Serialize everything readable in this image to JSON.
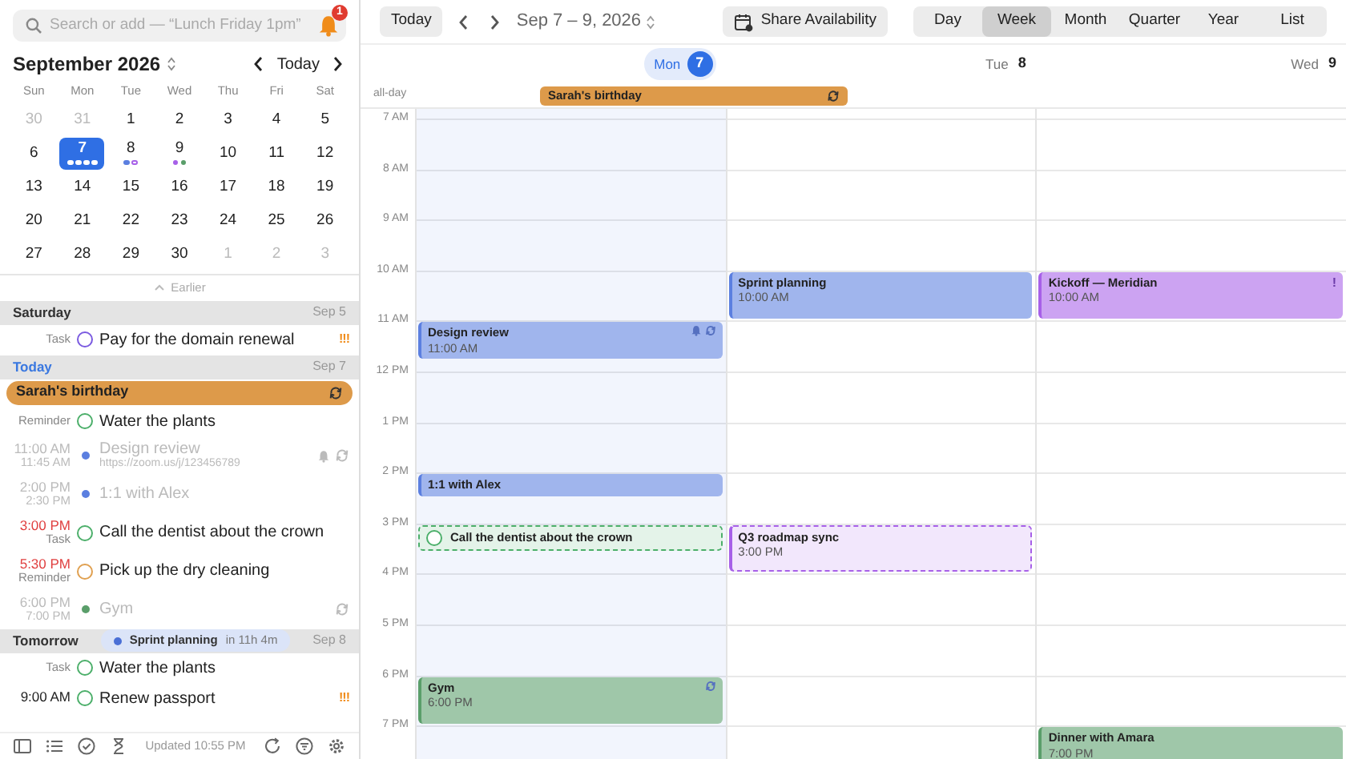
{
  "search": {
    "placeholder": "Search or add — “Lunch Friday 1pm”",
    "notifications": "1"
  },
  "mini_calendar": {
    "title": "September 2026",
    "today_button": "Today",
    "weekdays": [
      "Sun",
      "Mon",
      "Tue",
      "Wed",
      "Thu",
      "Fri",
      "Sat"
    ],
    "weeks": [
      [
        {
          "label": "30",
          "other_month": true,
          "selected": false
        },
        {
          "label": "31",
          "other_month": true,
          "selected": false
        },
        {
          "label": "1",
          "other_month": false,
          "selected": false
        },
        {
          "label": "2",
          "other_month": false,
          "selected": false
        },
        {
          "label": "3",
          "other_month": false,
          "selected": false
        },
        {
          "label": "4",
          "other_month": false,
          "selected": false
        },
        {
          "label": "5",
          "other_month": false,
          "selected": false
        }
      ],
      [
        {
          "label": "6",
          "other_month": false,
          "selected": false
        },
        {
          "label": "7",
          "other_month": false,
          "selected": true,
          "dots": [
            {
              "color": "#ffffff",
              "kind": "event"
            },
            {
              "color": "#ffffff",
              "kind": "event"
            },
            {
              "color": "#ffffff",
              "kind": "event"
            },
            {
              "color": "#ffffff",
              "kind": "event"
            }
          ]
        },
        {
          "label": "8",
          "other_month": false,
          "selected": false,
          "dots": [
            {
              "color": "#5b7fe0",
              "kind": "event"
            },
            {
              "color": "#a760e8",
              "kind": "task"
            }
          ]
        },
        {
          "label": "9",
          "other_month": false,
          "selected": false,
          "dots": [
            {
              "color": "#a760e8",
              "kind": "event"
            },
            {
              "color": "#5a9e6a",
              "kind": "event"
            }
          ]
        },
        {
          "label": "10",
          "other_month": false,
          "selected": false
        },
        {
          "label": "11",
          "other_month": false,
          "selected": false
        },
        {
          "label": "12",
          "other_month": false,
          "selected": false
        }
      ],
      [
        {
          "label": "13",
          "other_month": false,
          "selected": false
        },
        {
          "label": "14",
          "other_month": false,
          "selected": false
        },
        {
          "label": "15",
          "other_month": false,
          "selected": false
        },
        {
          "label": "16",
          "other_month": false,
          "selected": false
        },
        {
          "label": "17",
          "other_month": false,
          "selected": false
        },
        {
          "label": "18",
          "other_month": false,
          "selected": false
        },
        {
          "label": "19",
          "other_month": false,
          "selected": false
        }
      ],
      [
        {
          "label": "20",
          "other_month": false,
          "selected": false
        },
        {
          "label": "21",
          "other_month": false,
          "selected": false
        },
        {
          "label": "22",
          "other_month": false,
          "selected": false
        },
        {
          "label": "23",
          "other_month": false,
          "selected": false
        },
        {
          "label": "24",
          "other_month": false,
          "selected": false
        },
        {
          "label": "25",
          "other_month": false,
          "selected": false
        },
        {
          "label": "26",
          "other_month": false,
          "selected": false
        }
      ],
      [
        {
          "label": "27",
          "other_month": false,
          "selected": false
        },
        {
          "label": "28",
          "other_month": false,
          "selected": false
        },
        {
          "label": "29",
          "other_month": false,
          "selected": false
        },
        {
          "label": "30",
          "other_month": false,
          "selected": false
        },
        {
          "label": "1",
          "other_month": true,
          "selected": false
        },
        {
          "label": "2",
          "other_month": true,
          "selected": false
        },
        {
          "label": "3",
          "other_month": true,
          "selected": false
        }
      ]
    ]
  },
  "earlier": "Earlier",
  "agenda": [
    {
      "title": "Saturday",
      "date": "Sep 5",
      "today": false,
      "items": [
        {
          "kind": "task",
          "sub": "Task",
          "title": "Pay for the domain renewal",
          "color": "#7a5ae0",
          "priority": "!!!",
          "past": false
        }
      ]
    },
    {
      "title": "Today",
      "date": "Sep 7",
      "today": true,
      "items": [
        {
          "kind": "allday",
          "title": "Sarah's birthday",
          "color": "#dd9a4a",
          "repeats": true
        },
        {
          "kind": "task",
          "sub": "Reminder",
          "title": "Water the plants",
          "color": "#4caf6a",
          "past": false
        },
        {
          "kind": "event",
          "time": "11:00 AM",
          "end": "11:45 AM",
          "title": "Design review",
          "link": "https://zoom.us/j/123456789",
          "color": "#5b7fe0",
          "past": true,
          "overdue": false,
          "alert": true,
          "repeats": true
        },
        {
          "kind": "event",
          "time": "2:00 PM",
          "end": "2:30 PM",
          "title": "1:1 with Alex",
          "color": "#5b7fe0",
          "past": true,
          "overdue": false
        },
        {
          "kind": "task",
          "time": "3:00 PM",
          "sub": "Task",
          "title": "Call the dentist about the crown",
          "color": "#4caf6a",
          "past": false,
          "overdue": true
        },
        {
          "kind": "task",
          "time": "5:30 PM",
          "sub": "Reminder",
          "title": "Pick up the dry cleaning",
          "color": "#e0a050",
          "past": false,
          "overdue": true
        },
        {
          "kind": "event",
          "time": "6:00 PM",
          "end": "7:00 PM",
          "title": "Gym",
          "color": "#5a9e6a",
          "past": true,
          "overdue": false,
          "repeats": true
        }
      ]
    },
    {
      "title": "Tomorrow",
      "date": "Sep 8",
      "today": false,
      "toast": {
        "title": "Sprint planning",
        "eta": "in 11h 4m",
        "color": "#4a6fd6"
      },
      "items": [
        {
          "kind": "task",
          "sub": "Task",
          "title": "Water the plants",
          "color": "#4caf6a",
          "past": false
        },
        {
          "kind": "task",
          "time": "9:00 AM",
          "title": "Renew passport",
          "color": "#4caf6a",
          "priority": "!!!",
          "past": false,
          "overdue": false
        }
      ]
    }
  ],
  "footer": {
    "status": "Updated 10:55 PM"
  },
  "toolbar": {
    "today": "Today",
    "range": "Sep 7 – 9, 2026",
    "share": "Share Availability",
    "views": [
      {
        "label": "Day",
        "selected": false
      },
      {
        "label": "Week",
        "selected": true
      },
      {
        "label": "Month",
        "selected": false
      },
      {
        "label": "Quarter",
        "selected": false
      },
      {
        "label": "Year",
        "selected": false
      },
      {
        "label": "List",
        "selected": false
      }
    ]
  },
  "week": {
    "all_day_label": "all-day",
    "all_day": [
      {
        "title": "Sarah's birthday",
        "color": "#dd9a4a",
        "repeats": true
      }
    ],
    "days": [
      {
        "weekday": "Mon",
        "date": "7",
        "selected": true
      },
      {
        "weekday": "Tue",
        "date": "8",
        "selected": false
      },
      {
        "weekday": "Wed",
        "date": "9",
        "selected": false
      }
    ],
    "hours": [
      {
        "label": "7 AM"
      },
      {
        "label": "8 AM"
      },
      {
        "label": "9 AM"
      },
      {
        "label": "10 AM",
        "day_2": [
          {
            "kind": "event",
            "title": "Sprint planning",
            "time": "10:00 AM",
            "color": "#5b7fe0",
            "short": false
          }
        ],
        "day_3": [
          {
            "kind": "event",
            "title": "Kickoff — Meridian",
            "time": "10:00 AM",
            "color": "#a760e8",
            "short": false,
            "priority": "!"
          }
        ]
      },
      {
        "label": "11 AM",
        "day_1": [
          {
            "kind": "event",
            "title": "Design review",
            "time": "11:00 AM",
            "color": "#5b7fe0",
            "short": true,
            "alert": true,
            "repeats": true
          }
        ]
      },
      {
        "label": "12 PM"
      },
      {
        "label": "1 PM"
      },
      {
        "label": "2 PM",
        "day_1": [
          {
            "kind": "event",
            "title": "1:1 with Alex",
            "color": "#5b7fe0",
            "short": true
          }
        ]
      },
      {
        "label": "3 PM",
        "day_1": [
          {
            "kind": "task",
            "title": "Call the dentist about the crown",
            "color": "#4caf6a",
            "short": true
          }
        ],
        "day_2": [
          {
            "kind": "tentative",
            "title": "Q3 roadmap sync",
            "time": "3:00 PM",
            "color": "#a760e8",
            "short": false
          }
        ]
      },
      {
        "label": "4 PM"
      },
      {
        "label": "5 PM"
      },
      {
        "label": "6 PM",
        "day_1": [
          {
            "kind": "event",
            "title": "Gym",
            "time": "6:00 PM",
            "color": "#5a9e6a",
            "short": false,
            "repeats": true
          }
        ]
      },
      {
        "label": "7 PM",
        "day_3": [
          {
            "kind": "event",
            "title": "Dinner with Amara",
            "time": "7:00 PM",
            "color": "#5a9e6a"
          }
        ]
      }
    ]
  }
}
